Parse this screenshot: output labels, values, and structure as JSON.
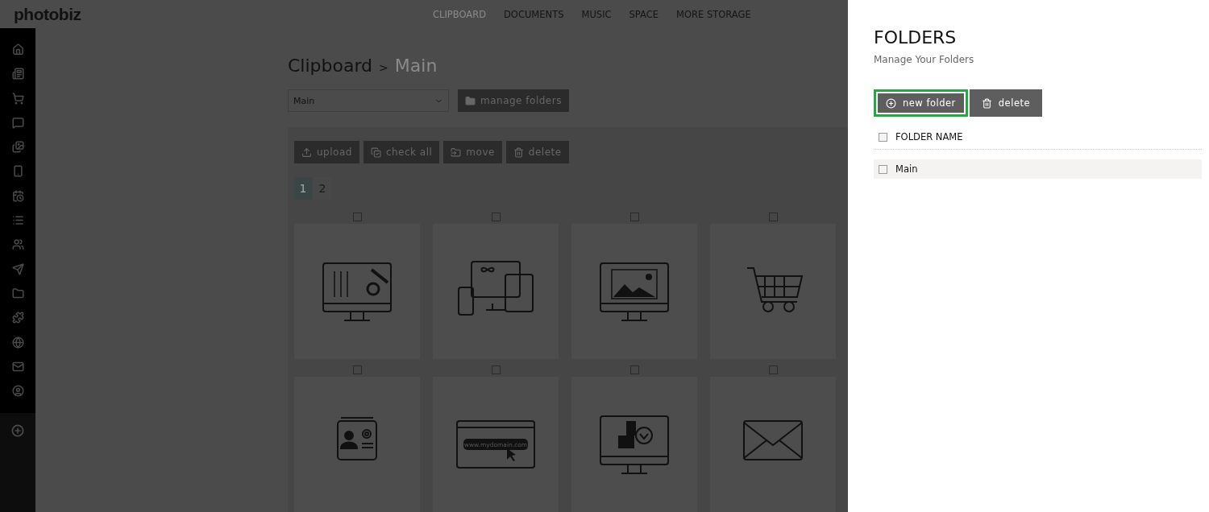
{
  "header": {
    "logo": "photobiz",
    "nav": [
      {
        "label": "CLIPBOARD",
        "selected": true
      },
      {
        "label": "DOCUMENTS",
        "selected": false
      },
      {
        "label": "MUSIC",
        "selected": false
      },
      {
        "label": "SPACE",
        "selected": false
      },
      {
        "label": "MORE STORAGE",
        "selected": false
      }
    ]
  },
  "breadcrumb": {
    "parent": "Clipboard",
    "separator": ">",
    "current": "Main"
  },
  "folder_select": {
    "value": "Main"
  },
  "manage_button": {
    "label": "manage folders"
  },
  "toolbar": [
    {
      "kind": "upload",
      "label": "upload"
    },
    {
      "kind": "check",
      "label": "check all"
    },
    {
      "kind": "move",
      "label": "move"
    },
    {
      "kind": "delete",
      "label": "delete"
    }
  ],
  "pages": [
    {
      "label": "1",
      "selected": true
    },
    {
      "label": "2",
      "selected": false
    }
  ],
  "tiles": [
    {
      "kind": "settings",
      "checked": false
    },
    {
      "kind": "devices",
      "checked": false
    },
    {
      "kind": "picture",
      "checked": false
    },
    {
      "kind": "cart",
      "checked": false
    },
    {
      "kind": "contact",
      "checked": false
    },
    {
      "kind": "domain",
      "checked": false,
      "image_text": "www.mydomain.com"
    },
    {
      "kind": "download",
      "checked": false
    },
    {
      "kind": "mail",
      "checked": false
    }
  ],
  "panel": {
    "title": "FOLDERS",
    "subtitle": "Manage Your Folders",
    "buttons": [
      {
        "kind": "add",
        "label": "new folder",
        "highlighted": true
      },
      {
        "kind": "delete",
        "label": "delete",
        "highlighted": false
      }
    ],
    "header": {
      "label": "FOLDER NAME",
      "checked": false
    },
    "rows": [
      {
        "name": "Main",
        "checked": false
      }
    ]
  }
}
